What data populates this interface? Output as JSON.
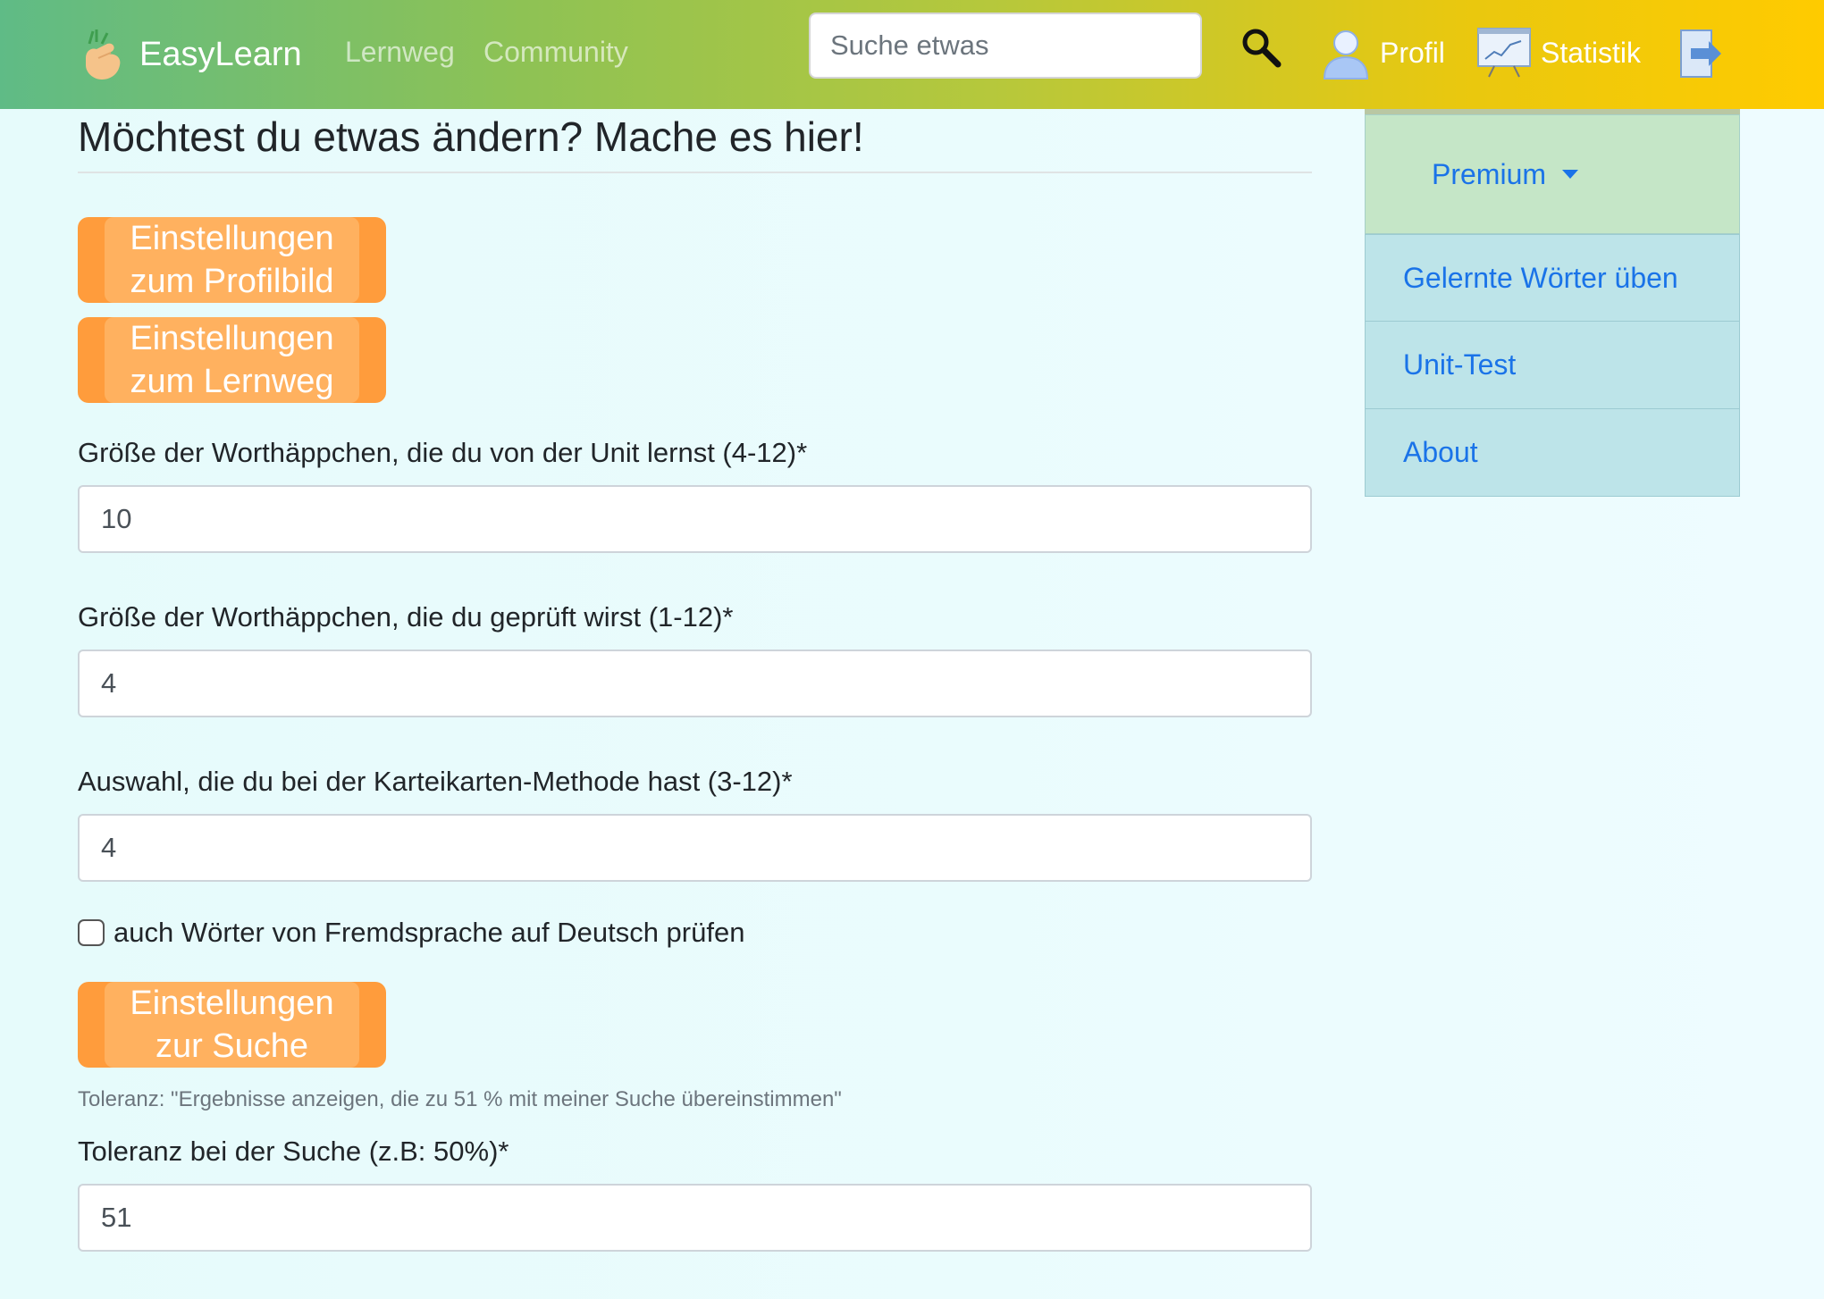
{
  "navbar": {
    "brand": "EasyLearn",
    "links": {
      "lernweg": "Lernweg",
      "community": "Community"
    },
    "search": {
      "placeholder": "Suche etwas",
      "value": ""
    },
    "profil": "Profil",
    "statistik": "Statistik",
    "icons": [
      "hand-logo-icon",
      "magnifier-search-icon",
      "user-icon",
      "statistics-chart-icon",
      "logout-arrow-icon"
    ]
  },
  "form": {
    "title": "Möchtest du etwas ändern? Mache es hier!",
    "btn_profilbild": "Einstellungen zum Profilbild",
    "btn_lernweg": "Einstellungen zum Lernweg",
    "fields": [
      {
        "label": "Größe der Worthäppchen, die du von der Unit lernst (4-12)*",
        "value": "10"
      },
      {
        "label": "Größe der Worthäppchen, die du geprüft wirst (1-12)*",
        "value": "4"
      },
      {
        "label": "Auswahl, die du bei der Karteikarten-Methode hast (3-12)*",
        "value": "4"
      }
    ],
    "checkbox": {
      "label": "auch Wörter von Fremdsprache auf Deutsch prüfen",
      "checked": false
    },
    "btn_suche": "Einstellungen zur Suche",
    "hint": "Toleranz: \"Ergebnisse anzeigen, die zu 51 % mit meiner Suche übereinstimmen\"",
    "tolerance": {
      "label": "Toleranz bei der Suche (z.B: 50%)*",
      "value": "51"
    }
  },
  "sidebar": {
    "premium": "Premium",
    "items": [
      "Gelernte Wörter üben",
      "Unit-Test",
      "About"
    ]
  },
  "colors": {
    "navbar_gradient": [
      "#5fbb86",
      "#ffcb00"
    ],
    "orange_button": "#ff9c3c",
    "link_blue": "#1a73e8",
    "premium_bg": "#c5e6c7",
    "sidebar_item_bg": "#bde4e9"
  }
}
